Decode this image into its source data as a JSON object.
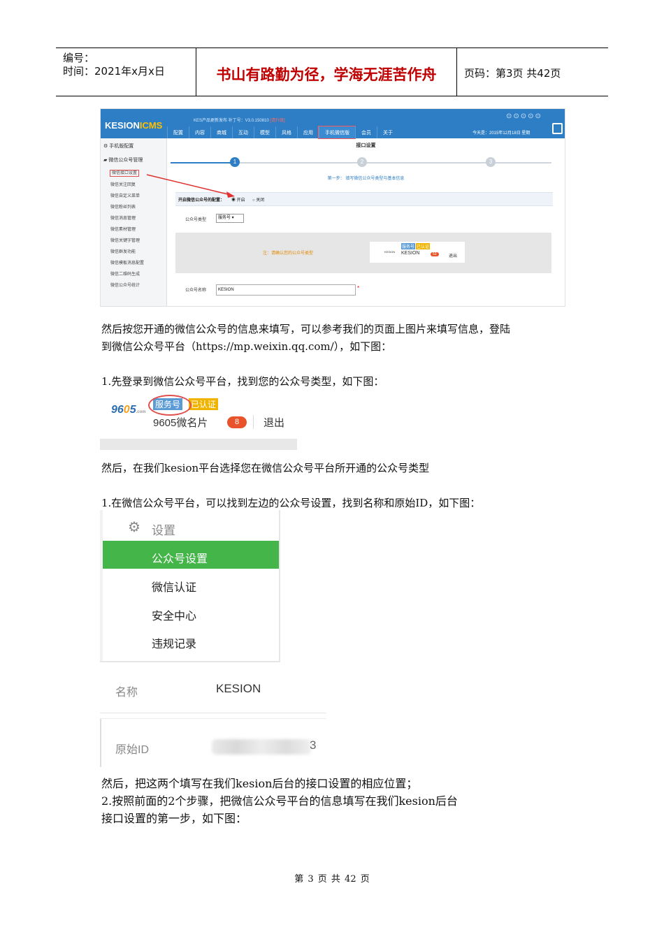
{
  "header": {
    "number_label": "编号：",
    "time_label": "时间：2021年x月x日",
    "motto": "书山有路勤为径，学海无涯苦作舟",
    "page_label": "页码：第3页  共42页"
  },
  "cms": {
    "logo_a": "KESION",
    "logo_b": "ICMS",
    "version": "KES产品更新发布 补丁号：V3.0.150810",
    "version_tag": "[请升级]",
    "menu": [
      "配置",
      "内容",
      "商城",
      "互动",
      "模型",
      "风格",
      "应用",
      "手机微信版",
      "会员",
      "关于"
    ],
    "active_menu": "手机微信版",
    "date": "今天是：2015年12月18日 星期",
    "side_heads": [
      "手机版配置",
      "微信公众号管理"
    ],
    "side_items": [
      "微信接口设置",
      "微信关注回复",
      "微信自定义菜单",
      "微信粉丝列表",
      "微信消息管理",
      "微信素材管理",
      "微信关键字管理",
      "微信群发功能",
      "微信模板消息配置",
      "微信二维码生成",
      "微信公众号统计"
    ],
    "title": "接口设置",
    "steps": [
      "1",
      "2",
      "3"
    ],
    "step_caption": "第一步： 填写微信公众号类型与基本信息",
    "enable_label": "开启微信公众号的配置：",
    "enable_on": "◉ 开启",
    "enable_off": "○ 关闭",
    "type_label": "公众号类型",
    "type_value": "服务号",
    "note": "注：请确认您的公众号类型",
    "card_name": "KESION",
    "card_badge1": "服务号",
    "card_badge2": "已认证",
    "card_count": "53",
    "card_exit": "退出",
    "name_label": "公众号名称",
    "name_value": "KESION",
    "required": "*"
  },
  "para1": "然后按您开通的微信公众号的信息来填写，可以参考我们的页面上图片来填写信息，登陆",
  "para2": "到微信公众号平台（https://mp.weixin.qq.com/），如下图：",
  "para3": "1.先登录到微信公众号平台，找到您的公众号类型，如下图：",
  "wx1": {
    "logo": "9605",
    "badge1": "服务号",
    "badge2": "已认证",
    "name": "9605微名片",
    "count": "8",
    "exit": "退出"
  },
  "para4": "然后，在我们kesion平台选择您在微信公众号平台所开通的公众号类型",
  "para5": "1.在微信公众号平台，可以找到左边的公众号设置，找到名称和原始ID，如下图：",
  "wx2": {
    "header": "设置",
    "items": [
      "公众号设置",
      "微信认证",
      "安全中心",
      "违规记录"
    ]
  },
  "wx3": {
    "name_label": "名称",
    "name_value": "KESION",
    "id_label": "原始ID",
    "id_tail": "3"
  },
  "para6": "然后，把这两个填写在我们kesion后台的接口设置的相应位置；",
  "para7": "2.按照前面的2个步骤，把微信公众号平台的信息填写在我们kesion后台",
  "para8": "接口设置的第一步，如下图：",
  "footer": "第 3 页 共 42 页"
}
